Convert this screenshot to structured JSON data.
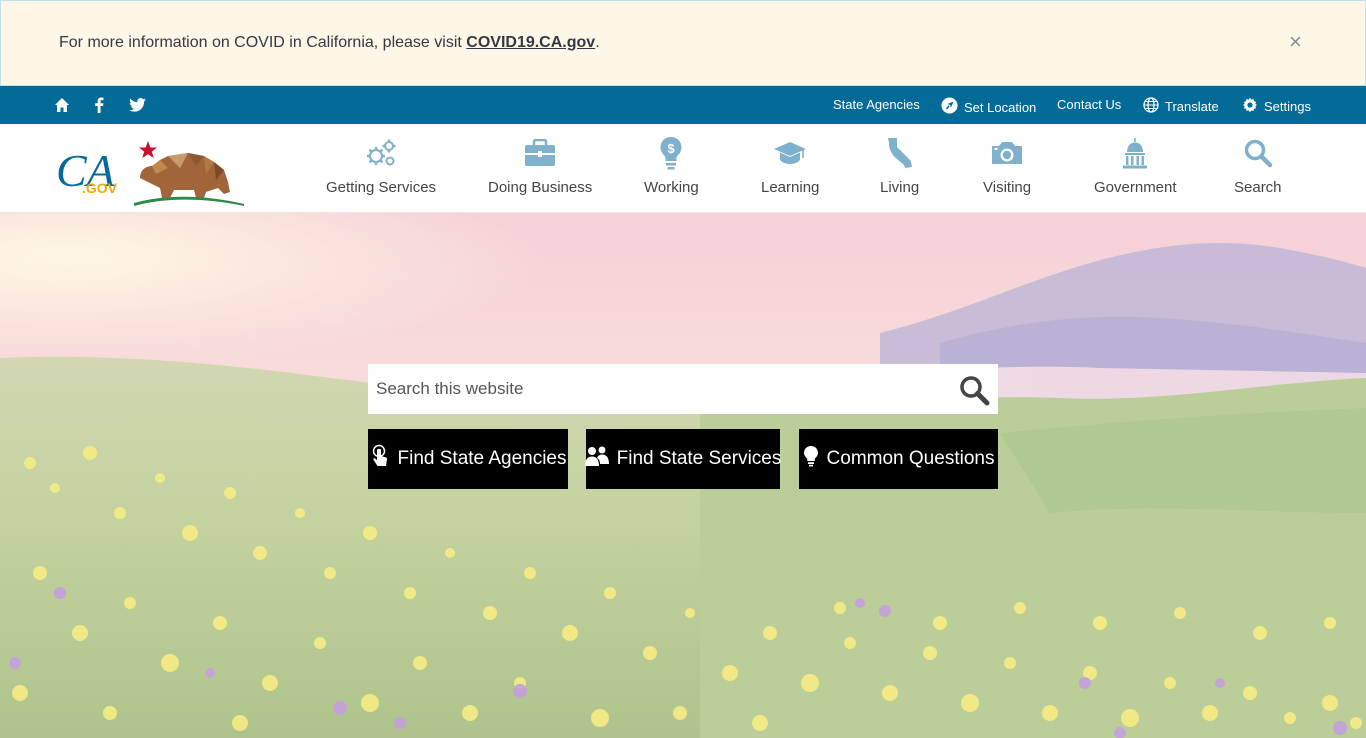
{
  "alert": {
    "text_prefix": "For more information on COVID in California, please visit ",
    "link_text": "COVID19.CA.gov",
    "text_suffix": ".",
    "close_label": "×"
  },
  "utility": {
    "links": {
      "state_agencies": "State Agencies",
      "set_location": "Set Location",
      "contact_us": "Contact Us",
      "translate": "Translate",
      "settings": "Settings"
    }
  },
  "logo": {
    "ca": "CA",
    "gov": ".GOV"
  },
  "nav": {
    "getting_services": "Getting Services",
    "doing_business": "Doing Business",
    "working": "Working",
    "learning": "Learning",
    "living": "Living",
    "visiting": "Visiting",
    "government": "Government",
    "search": "Search"
  },
  "hero": {
    "search_placeholder": "Search this website",
    "buttons": {
      "find_agencies": "Find State Agencies",
      "find_services": "Find State Services",
      "common_questions": "Common Questions"
    }
  },
  "colors": {
    "utility_bar": "#046b99",
    "alert_bg": "#fef6e6",
    "nav_icon": "#5a9bbd",
    "button_bg": "#000000"
  }
}
